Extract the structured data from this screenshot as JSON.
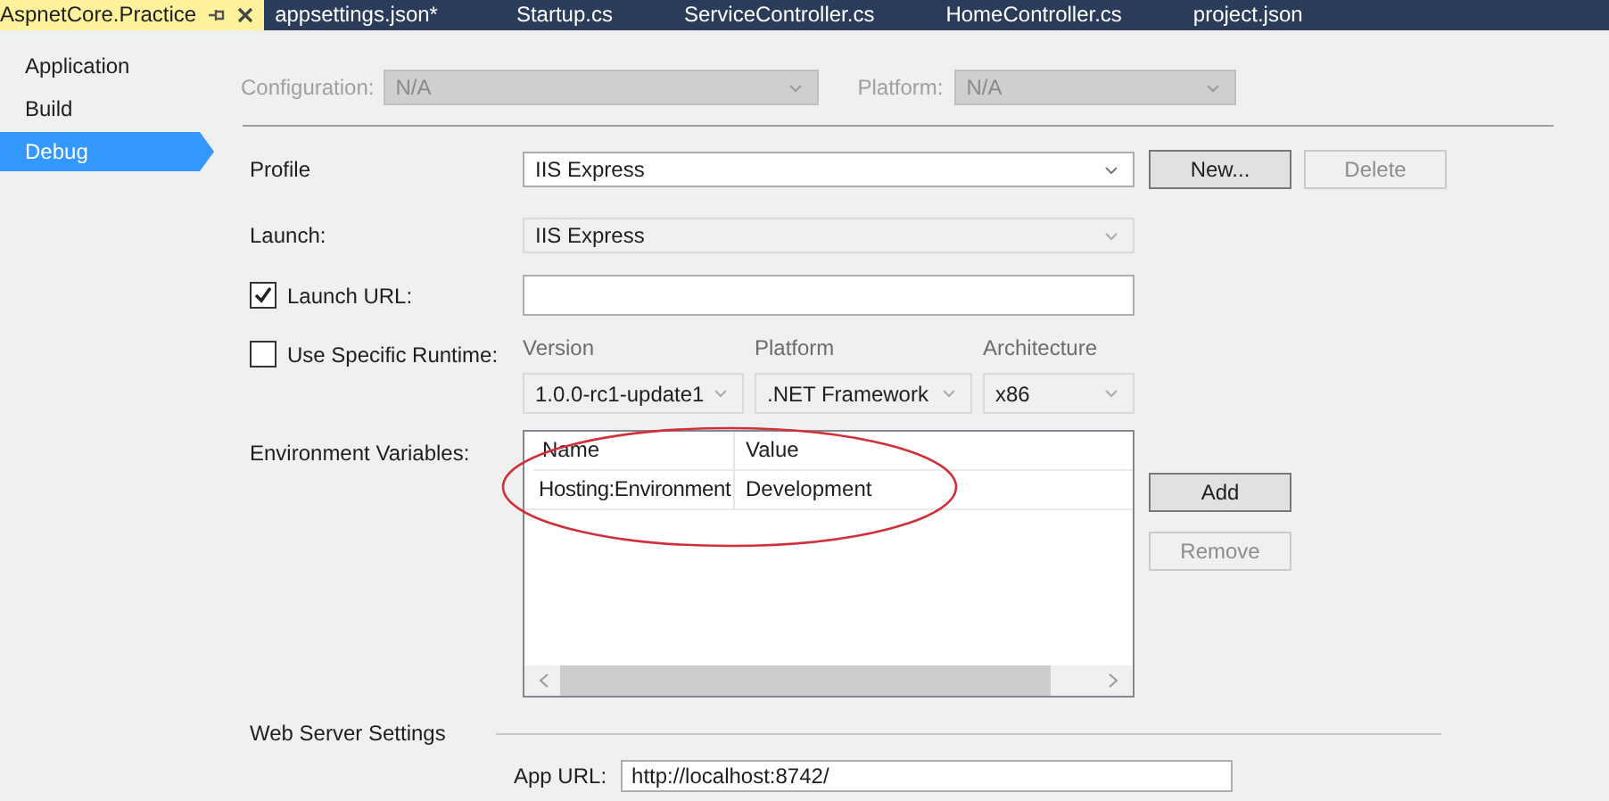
{
  "tabs": [
    {
      "label": "AspnetCore.Practice",
      "selected": true
    },
    {
      "label": "appsettings.json*",
      "selected": false
    },
    {
      "label": "Startup.cs",
      "selected": false
    },
    {
      "label": "ServiceController.cs",
      "selected": false
    },
    {
      "label": "HomeController.cs",
      "selected": false
    },
    {
      "label": "project.json",
      "selected": false
    }
  ],
  "sidebar": {
    "items": [
      {
        "label": "Application",
        "selected": false
      },
      {
        "label": "Build",
        "selected": false
      },
      {
        "label": "Debug",
        "selected": true
      }
    ]
  },
  "configuration": {
    "label": "Configuration:",
    "value": "N/A",
    "disabled": true
  },
  "platform": {
    "label": "Platform:",
    "value": "N/A",
    "disabled": true
  },
  "profile": {
    "label": "Profile",
    "value": "IIS Express",
    "buttons": [
      {
        "label": "New...",
        "disabled": false
      },
      {
        "label": "Delete",
        "disabled": true
      }
    ]
  },
  "launch": {
    "label": "Launch:",
    "value": "IIS Express",
    "disabled": true
  },
  "launch_url": {
    "label": "Launch URL:",
    "checked": true
  },
  "specific_runtime": {
    "label": "Use Specific Runtime:",
    "checked": false,
    "fields": [
      {
        "label": "Version",
        "value": "1.0.0-rc1-update1"
      },
      {
        "label": "Platform",
        "value": ".NET Framework"
      },
      {
        "label": "Architecture",
        "value": "x86"
      }
    ]
  },
  "environment_variables": {
    "label": "Environment Variables:",
    "columns": [
      "Name",
      "Value"
    ],
    "rows": [
      {
        "cells": [
          "Hosting:Environment",
          "Development"
        ]
      }
    ],
    "buttons": [
      {
        "label": "Add",
        "disabled": false
      },
      {
        "label": "Remove",
        "disabled": true
      }
    ]
  },
  "web_server_settings": {
    "label": "Web Server Settings"
  },
  "app_url": {
    "label": "App URL:",
    "value": "http://localhost:8742/"
  }
}
